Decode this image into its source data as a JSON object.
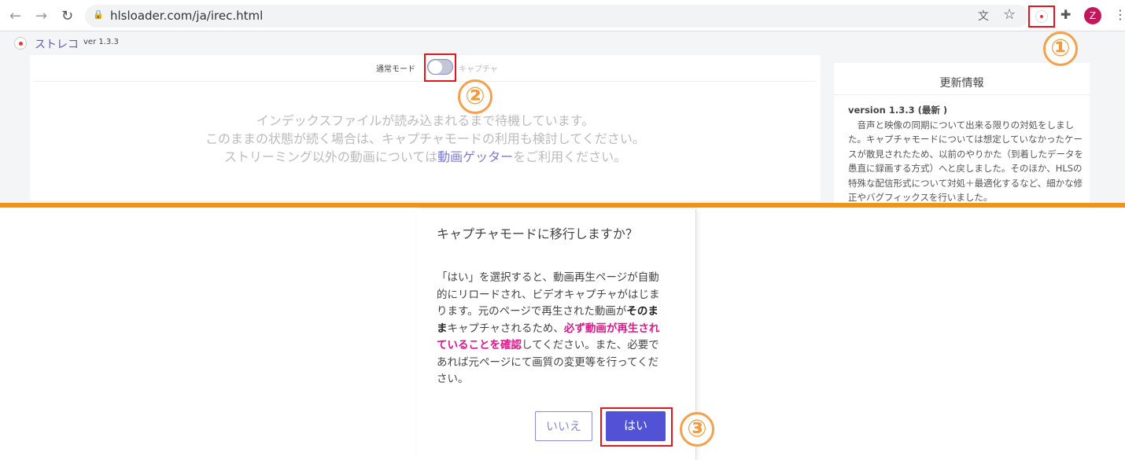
{
  "browser": {
    "url": "hlsloader.com/ja/irec.html",
    "avatar_letter": "Z"
  },
  "bookmark": {
    "app_name": "ストレコ",
    "version": "ver 1.3.3"
  },
  "toggle": {
    "left_label": "通常モード",
    "right_label": "キャプチャ",
    "state": "off"
  },
  "main": {
    "lines": [
      "インデックスファイルが読み込まれるまで待機しています。",
      "このままの状態が続く場合は、キャプチャモードの利用も検討してください。"
    ],
    "line3_pre": "ストリーミング以外の動画については",
    "line3_link": "動画ゲッター",
    "line3_post": "をご利用ください。"
  },
  "updates": {
    "title": "更新情報",
    "version": "version 1.3.3 (最新 )",
    "text": "音声と映像の同期について出来る限りの対処をしました。キャプチャモードについては想定していなかったケースが散見されたため、以前のやりかた（到着したデータを愚直に録画する方式）へと戻しました。そのほか、HLSの特殊な配信形式について対処＋最適化するなど、細かな修正やバグフィックスを行いました。"
  },
  "dialog": {
    "title": "キャプチャモードに移行しますか？",
    "p1": "「はい」を選択すると、動画再生ページが自動的にリロードされ、ビデオキャプチャがはじまります。元のページで再生された動画が",
    "bold": "そのまま",
    "p2": "キャプチャされるため、",
    "pink": "必ず動画が再生されていることを確認",
    "p3": "してください。また、必要であれば元ページにて画質の変更等を行ってください。",
    "no": "いいえ",
    "yes": "はい"
  },
  "steps": [
    "①",
    "②",
    "③"
  ]
}
